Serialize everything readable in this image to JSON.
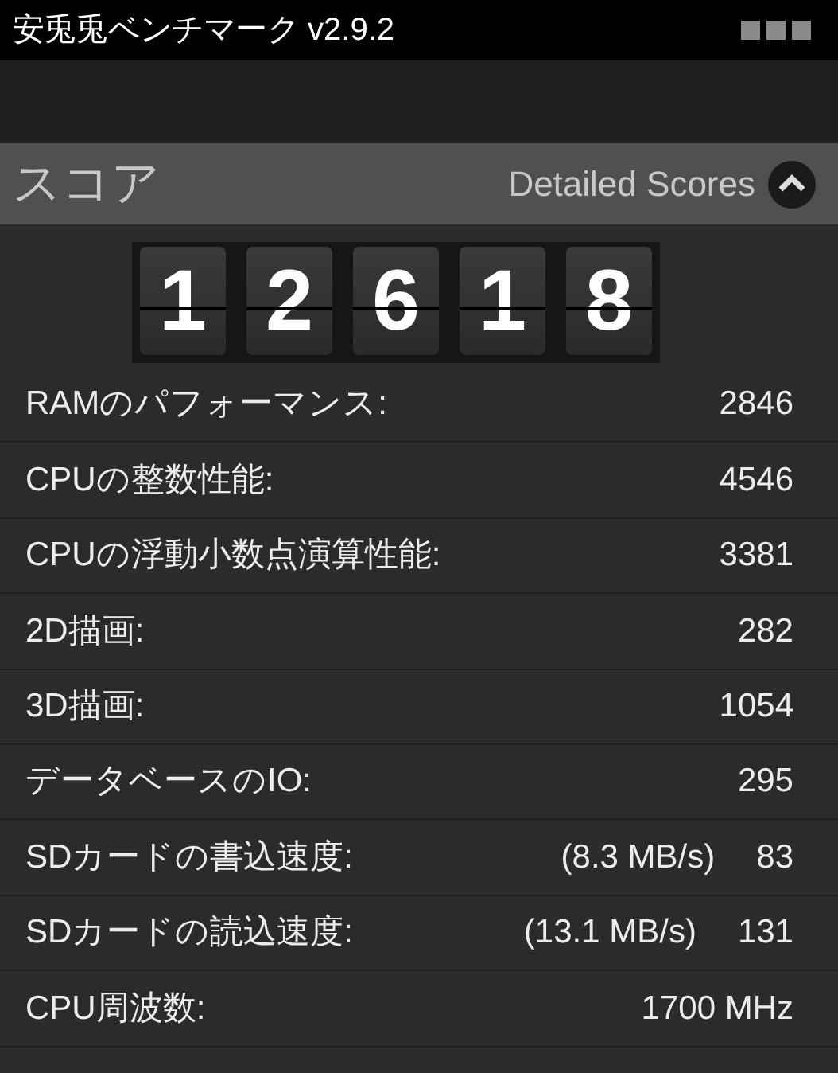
{
  "window": {
    "title": "安兎兎ベンチマーク v2.9.2"
  },
  "header": {
    "title": "スコア",
    "link": "Detailed Scores"
  },
  "score_digits": [
    "1",
    "2",
    "6",
    "1",
    "8"
  ],
  "rows": [
    {
      "label": "RAMのパフォーマンス:",
      "value": "2846"
    },
    {
      "label": "CPUの整数性能:",
      "value": "4546"
    },
    {
      "label": "CPUの浮動小数点演算性能:",
      "value": "3381"
    },
    {
      "label": "2D描画:",
      "value": "282"
    },
    {
      "label": "3D描画:",
      "value": "1054"
    },
    {
      "label": "データベースのIO:",
      "value": "295"
    },
    {
      "label": "SDカードの書込速度:",
      "detail": "(8.3 MB/s)",
      "value": "83"
    },
    {
      "label": "SDカードの読込速度:",
      "detail": "(13.1 MB/s)",
      "value": "131"
    },
    {
      "label": "CPU周波数:",
      "value": "1700 MHz"
    }
  ]
}
